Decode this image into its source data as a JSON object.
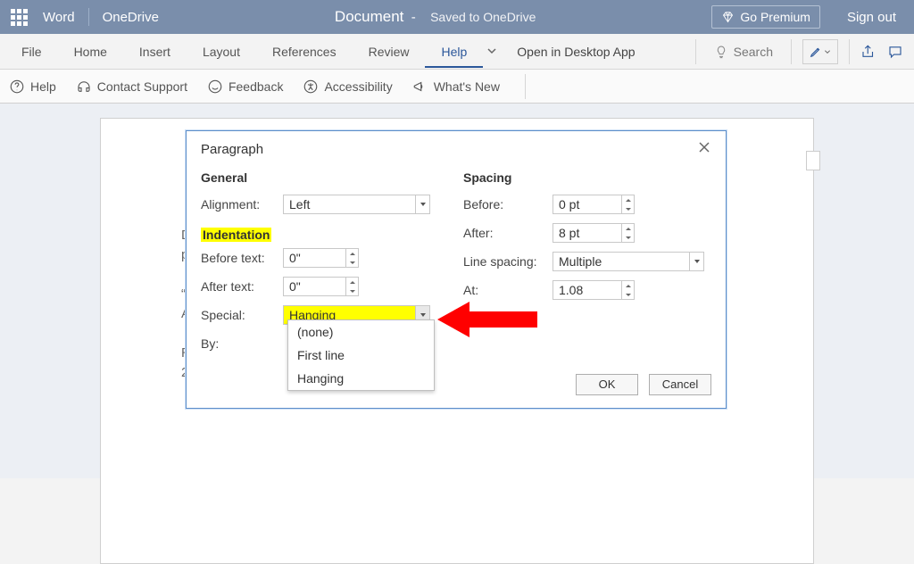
{
  "titlebar": {
    "app": "Word",
    "location": "OneDrive",
    "docname": "Document",
    "saved": "Saved to OneDrive",
    "premium": "Go Premium",
    "signout": "Sign out"
  },
  "tabs": {
    "file": "File",
    "home": "Home",
    "insert": "Insert",
    "layout": "Layout",
    "references": "References",
    "review": "Review",
    "help": "Help",
    "open_desktop": "Open in Desktop App",
    "search": "Search"
  },
  "subribbon": {
    "help": "Help",
    "contact": "Contact Support",
    "feedback": "Feedback",
    "accessibility": "Accessibility",
    "whatsnew": "What's New"
  },
  "page_fragments": [
    "D",
    "p",
    "“",
    "A",
    "R",
    "2"
  ],
  "dialog": {
    "title": "Paragraph",
    "general": {
      "heading": "General",
      "alignment_label": "Alignment:",
      "alignment_value": "Left"
    },
    "indentation": {
      "heading": "Indentation",
      "before_label": "Before text:",
      "before_value": "0\"",
      "after_label": "After text:",
      "after_value": "0\"",
      "special_label": "Special:",
      "special_value": "Hanging",
      "by_label": "By:",
      "options": [
        "(none)",
        "First line",
        "Hanging"
      ]
    },
    "spacing": {
      "heading": "Spacing",
      "before_label": "Before:",
      "before_value": "0 pt",
      "after_label": "After:",
      "after_value": "8 pt",
      "line_label": "Line spacing:",
      "line_value": "Multiple",
      "at_label": "At:",
      "at_value": "1.08"
    },
    "ok": "OK",
    "cancel": "Cancel"
  }
}
